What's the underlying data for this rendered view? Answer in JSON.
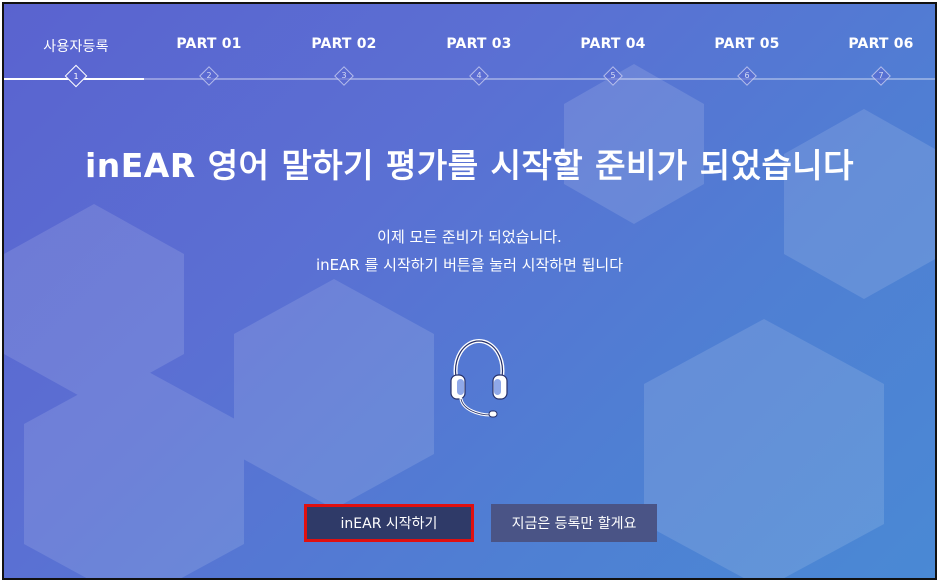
{
  "steps": [
    {
      "label": "사용자등록",
      "num": "1"
    },
    {
      "label": "PART 01",
      "num": "2"
    },
    {
      "label": "PART 02",
      "num": "3"
    },
    {
      "label": "PART 03",
      "num": "4"
    },
    {
      "label": "PART 04",
      "num": "5"
    },
    {
      "label": "PART 05",
      "num": "6"
    },
    {
      "label": "PART 06",
      "num": "7"
    }
  ],
  "title": "inEAR 영어 말하기 평가를 시작할 준비가 되었습니다",
  "description": {
    "line1": "이제 모든 준비가 되었습니다.",
    "line2": "inEAR 를 시작하기 버튼을 눌러 시작하면 됩니다"
  },
  "icons": {
    "headset": "headset-icon"
  },
  "buttons": {
    "start": "inEAR 시작하기",
    "later": "지금은 등록만 할게요"
  }
}
